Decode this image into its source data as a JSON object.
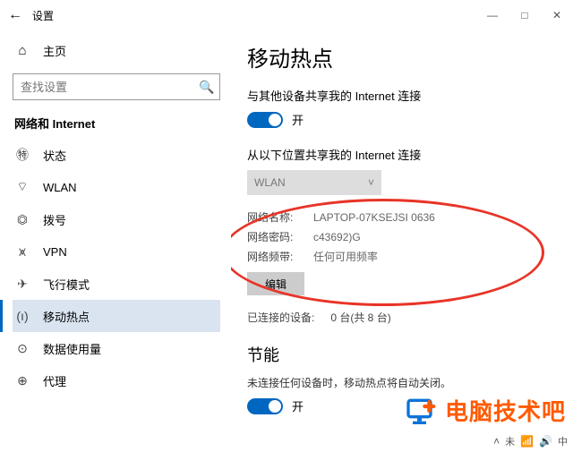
{
  "window": {
    "title": "设置",
    "controls": {
      "min": "—",
      "max": "□",
      "close": "✕",
      "back": "←"
    }
  },
  "sidebar": {
    "home_label": "主页",
    "search_placeholder": "查找设置",
    "category": "网络和 Internet",
    "items": [
      {
        "icon": "㊕",
        "label": "状态"
      },
      {
        "icon": "⌔",
        "label": "WLAN"
      },
      {
        "icon": "⏣",
        "label": "拨号"
      },
      {
        "icon": "⩙",
        "label": "VPN"
      },
      {
        "icon": "✈",
        "label": "飞行模式"
      },
      {
        "icon": "(ı)",
        "label": "移动热点"
      },
      {
        "icon": "⊙",
        "label": "数据使用量"
      },
      {
        "icon": "⊕",
        "label": "代理"
      }
    ]
  },
  "content": {
    "heading": "移动热点",
    "share_label": "与其他设备共享我的 Internet 连接",
    "toggle_on_label": "开",
    "from_label": "从以下位置共享我的 Internet 连接",
    "source_value": "WLAN",
    "network_name_label": "网络名称:",
    "network_name_value": "LAPTOP-07KSEJSI 0636",
    "network_password_label": "网络密码:",
    "network_password_value": "c43692)G",
    "network_band_label": "网络频带:",
    "network_band_value": "任何可用频率",
    "edit_label": "编辑",
    "connected_label": "已连接的设备:",
    "connected_value": "0 台(共 8 台)",
    "powersave_heading": "节能",
    "powersave_desc": "未连接任何设备时，移动热点将自动关闭。",
    "powersave_toggle_label": "开"
  },
  "watermark": "电脑技术吧",
  "tray": {
    "ime": "中",
    "time_prefix": "未",
    "wifi": "📶",
    "vol": "🔊"
  }
}
